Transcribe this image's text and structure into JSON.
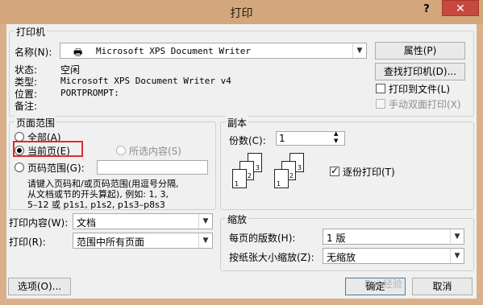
{
  "dialog": {
    "title": "打印",
    "help": "?",
    "close": "✕"
  },
  "printer": {
    "group_label": "打印机",
    "name_label": "名称(N):",
    "name_value": "Microsoft XPS Document Writer",
    "status_label": "状态:",
    "status_value": "空闲",
    "type_label": "类型:",
    "type_value": "Microsoft XPS Document Writer v4",
    "location_label": "位置:",
    "location_value": "PORTPROMPT:",
    "comment_label": "备注:",
    "properties_button": "属性(P)",
    "find_printer_button": "查找打印机(D)...",
    "print_to_file": "打印到文件(L)",
    "manual_duplex": "手动双面打印(X)"
  },
  "page_range": {
    "group_label": "页面范围",
    "all": "全部(A)",
    "current_page": "当前页(E)",
    "selection": "所选内容(S)",
    "pages": "页码范围(G):",
    "hint_line1": "请键入页码和/或页码范围(用逗号分隔,",
    "hint_line2": "从文档或节的开头算起), 例如: 1, 3,",
    "hint_line3": "5–12 或 p1s1, p1s2, p1s3–p8s3"
  },
  "copies": {
    "group_label": "副本",
    "count_label": "份数(C):",
    "count_value": "1",
    "collate": "逐份打印(T)"
  },
  "print_what": {
    "label": "打印内容(W):",
    "value": "文档"
  },
  "print": {
    "label": "打印(R):",
    "value": "范围中所有页面"
  },
  "zoom": {
    "group_label": "缩放",
    "pages_per_sheet_label": "每页的版数(H):",
    "pages_per_sheet_value": "1 版",
    "scale_label": "按纸张大小缩放(Z):",
    "scale_value": "无缩放"
  },
  "footer": {
    "options": "选项(O)...",
    "ok": "确定",
    "cancel": "取消"
  },
  "watermark": "Bai 经验"
}
